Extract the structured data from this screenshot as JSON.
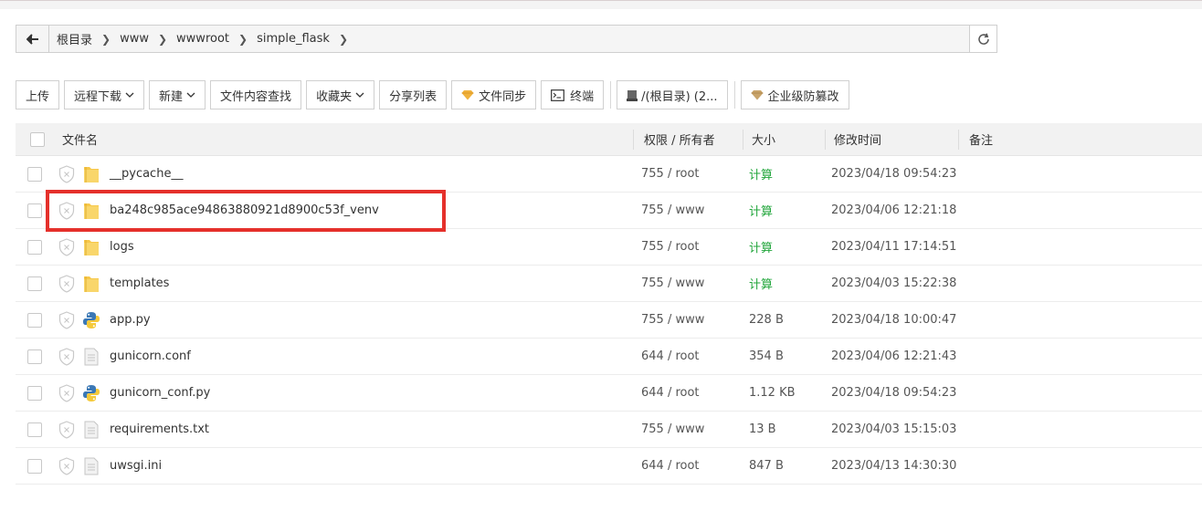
{
  "breadcrumb": [
    "根目录",
    "www",
    "wwwroot",
    "simple_flask"
  ],
  "toolbar": {
    "upload": "上传",
    "remote_download": "远程下载",
    "new": "新建",
    "content_search": "文件内容查找",
    "favorites": "收藏夹",
    "share_list": "分享列表",
    "file_sync": "文件同步",
    "terminal": "终端",
    "disk": "/(根目录) (2...",
    "anti_tamper": "企业级防篡改"
  },
  "table": {
    "headers": {
      "name": "文件名",
      "perm": "权限 / 所有者",
      "size": "大小",
      "mtime": "修改时间",
      "note": "备注"
    },
    "rows": [
      {
        "name": "__pycache__",
        "perm": "755 / root",
        "size": "计算",
        "mtime": "2023/04/18 09:54:23",
        "type": "folder"
      },
      {
        "name": "ba248c985ace94863880921d8900c53f_venv",
        "perm": "755 / www",
        "size": "计算",
        "mtime": "2023/04/06 12:21:18",
        "type": "folder"
      },
      {
        "name": "logs",
        "perm": "755 / root",
        "size": "计算",
        "mtime": "2023/04/11 17:14:51",
        "type": "folder"
      },
      {
        "name": "templates",
        "perm": "755 / www",
        "size": "计算",
        "mtime": "2023/04/03 15:22:38",
        "type": "folder"
      },
      {
        "name": "app.py",
        "perm": "755 / www",
        "size": "228 B",
        "mtime": "2023/04/18 10:00:47",
        "type": "python"
      },
      {
        "name": "gunicorn.conf",
        "perm": "644 / root",
        "size": "354 B",
        "mtime": "2023/04/06 12:21:43",
        "type": "file"
      },
      {
        "name": "gunicorn_conf.py",
        "perm": "644 / root",
        "size": "1.12 KB",
        "mtime": "2023/04/18 09:54:23",
        "type": "python"
      },
      {
        "name": "requirements.txt",
        "perm": "755 / www",
        "size": "13 B",
        "mtime": "2023/04/03 15:15:03",
        "type": "file"
      },
      {
        "name": "uwsgi.ini",
        "perm": "644 / root",
        "size": "847 B",
        "mtime": "2023/04/13 14:30:30",
        "type": "file"
      }
    ]
  },
  "colors": {
    "calc": "#20a53a",
    "highlight": "#e5302b",
    "folder": "#f7c84a",
    "gem": "#f0b23c"
  }
}
